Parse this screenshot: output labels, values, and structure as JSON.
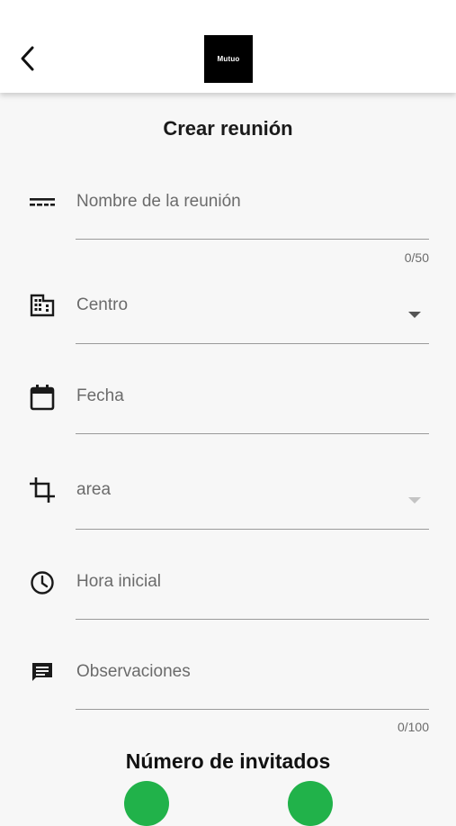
{
  "header": {
    "back_icon": "chevron-left-icon",
    "logo_text": "Mutuo"
  },
  "page": {
    "title": "Crear reunión"
  },
  "form": {
    "meeting_name": {
      "label": "Nombre de la reunión",
      "counter": "0/50",
      "icon": "short-text-icon"
    },
    "center": {
      "label": "Centro",
      "icon": "building-icon"
    },
    "date": {
      "label": "Fecha",
      "icon": "calendar-icon"
    },
    "area": {
      "label": "area",
      "icon": "crop-icon"
    },
    "start_time": {
      "label": "Hora inicial",
      "icon": "clock-icon"
    },
    "notes": {
      "label": "Observaciones",
      "counter": "0/100",
      "icon": "comment-icon"
    }
  },
  "guests": {
    "title": "Número de invitados"
  },
  "colors": {
    "accent_green": "#21b24a",
    "appbar": "#ffffff",
    "background": "#f7f7f7"
  }
}
